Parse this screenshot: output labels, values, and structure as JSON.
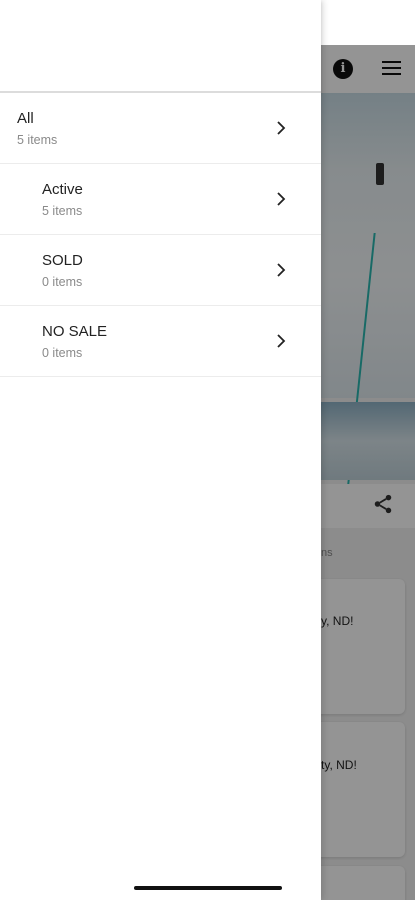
{
  "drawer": {
    "items": [
      {
        "label": "All",
        "count": "5 items"
      },
      {
        "label": "Active",
        "count": "5 items"
      },
      {
        "label": "SOLD",
        "count": "0 items"
      },
      {
        "label": "NO SALE",
        "count": "0 items"
      }
    ]
  },
  "background": {
    "section_hint": "ns",
    "card1_snippet": "y, ND!",
    "card2_snippet": "ty, ND!",
    "info_icon": "info-icon",
    "menu_icon": "hamburger-icon",
    "share_icon": "share-icon"
  },
  "colors": {
    "accent_teal": "#2ab7b0",
    "scrim": "rgba(0,0,0,0.42)"
  }
}
